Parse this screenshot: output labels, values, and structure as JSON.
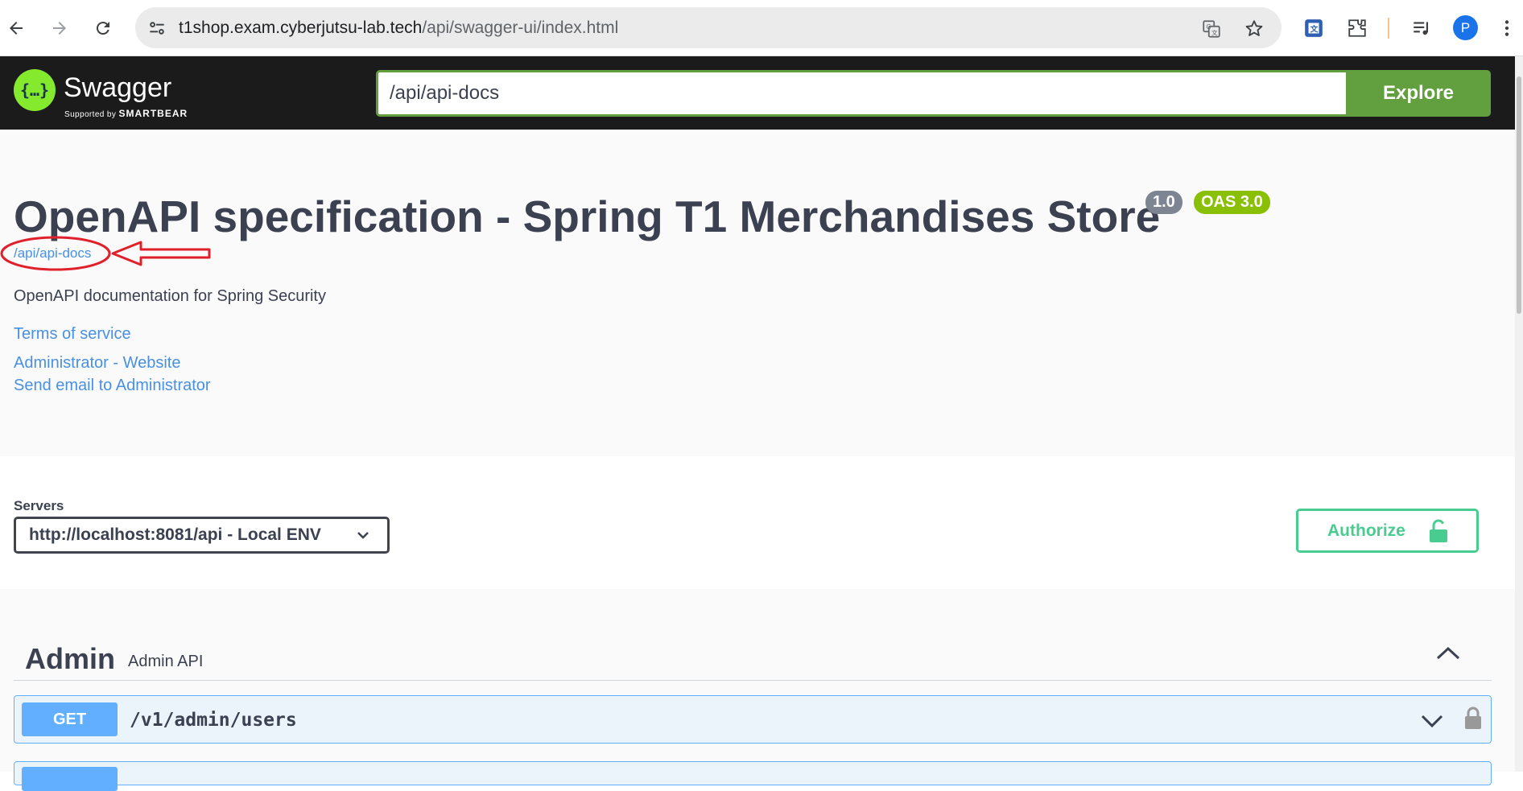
{
  "browser": {
    "url_host": "t1shop.exam.cyberjutsu-lab.tech",
    "url_path": "/api/swagger-ui/index.html",
    "profile_initial": "P"
  },
  "topbar": {
    "logo_name": "Swagger",
    "logo_supported": "Supported by",
    "logo_brand": "SMARTBEAR",
    "spec_url": "/api/api-docs",
    "explore_label": "Explore"
  },
  "info": {
    "title": "OpenAPI specification - Spring T1 Merchandises Store",
    "version": "1.0",
    "oas": "OAS 3.0",
    "spec_link": "/api/api-docs",
    "description": "OpenAPI documentation for Spring Security",
    "terms": "Terms of service",
    "contact_website": "Administrator - Website",
    "contact_email": "Send email to Administrator"
  },
  "servers": {
    "label": "Servers",
    "selected": "http://localhost:8081/api - Local ENV",
    "authorize_label": "Authorize"
  },
  "tags": [
    {
      "name": "Admin",
      "description": "Admin API",
      "operations": [
        {
          "method": "GET",
          "path": "/v1/admin/users"
        }
      ]
    }
  ],
  "colors": {
    "get": "#61affe",
    "swagger_green": "#85ea2d",
    "explore_green": "#62a03f",
    "authorize_green": "#49cc90",
    "annotation_red": "#e0202a"
  }
}
